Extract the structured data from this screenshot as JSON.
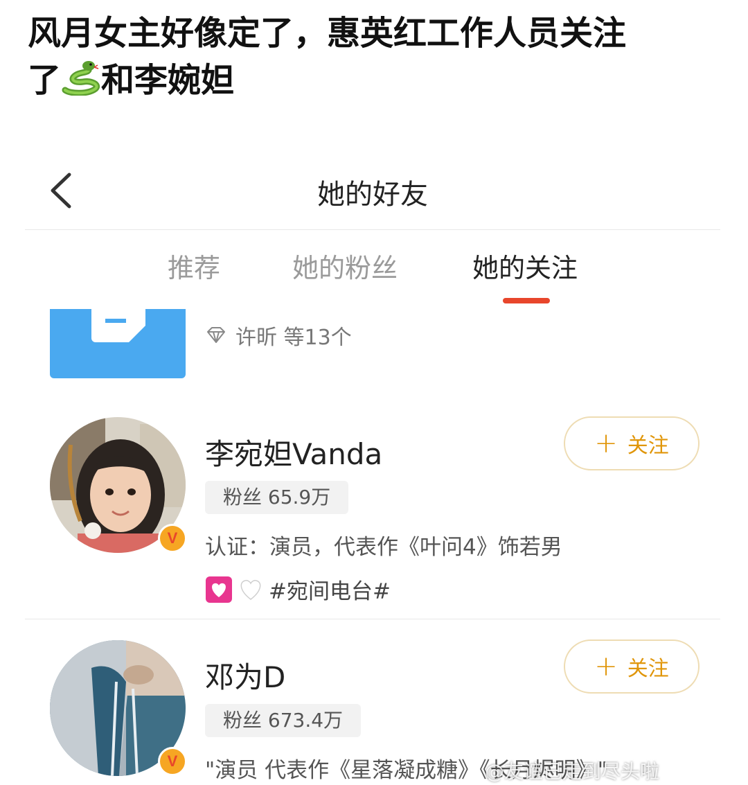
{
  "post": {
    "title_line1": "风月女主好像定了，惠英红工作人员关注",
    "title_line2_before": "了",
    "title_line2_after": "和李婉妲",
    "emoji": "snake-emoji"
  },
  "nav": {
    "title": "她的好友",
    "back_icon": "chevron-left-icon"
  },
  "tabs": [
    {
      "label": "推荐",
      "active": false
    },
    {
      "label": "她的粉丝",
      "active": false
    },
    {
      "label": "她的关注",
      "active": true
    }
  ],
  "accent_colors": {
    "tab_indicator": "#e8462b",
    "follow": "#e0960a",
    "verified_badge": "#f6a623"
  },
  "partial_item": {
    "meta": "许昕 等13个",
    "icon": "diamond-icon"
  },
  "users": [
    {
      "name": "李宛妲Vanda",
      "fans": "粉丝 65.9万",
      "bio": "认证：演员，代表作《叶问4》饰若男",
      "tagline": "#宛间电台#",
      "verified": "V",
      "follow_label": "关注"
    },
    {
      "name": "邓为D",
      "fans": "粉丝 673.4万",
      "bio": "\"演员 代表作《星落凝成糖》《长月烬明》\"",
      "verified": "V",
      "follow_label": "关注"
    }
  ],
  "watermark": "@友谊已走到尽头啦"
}
